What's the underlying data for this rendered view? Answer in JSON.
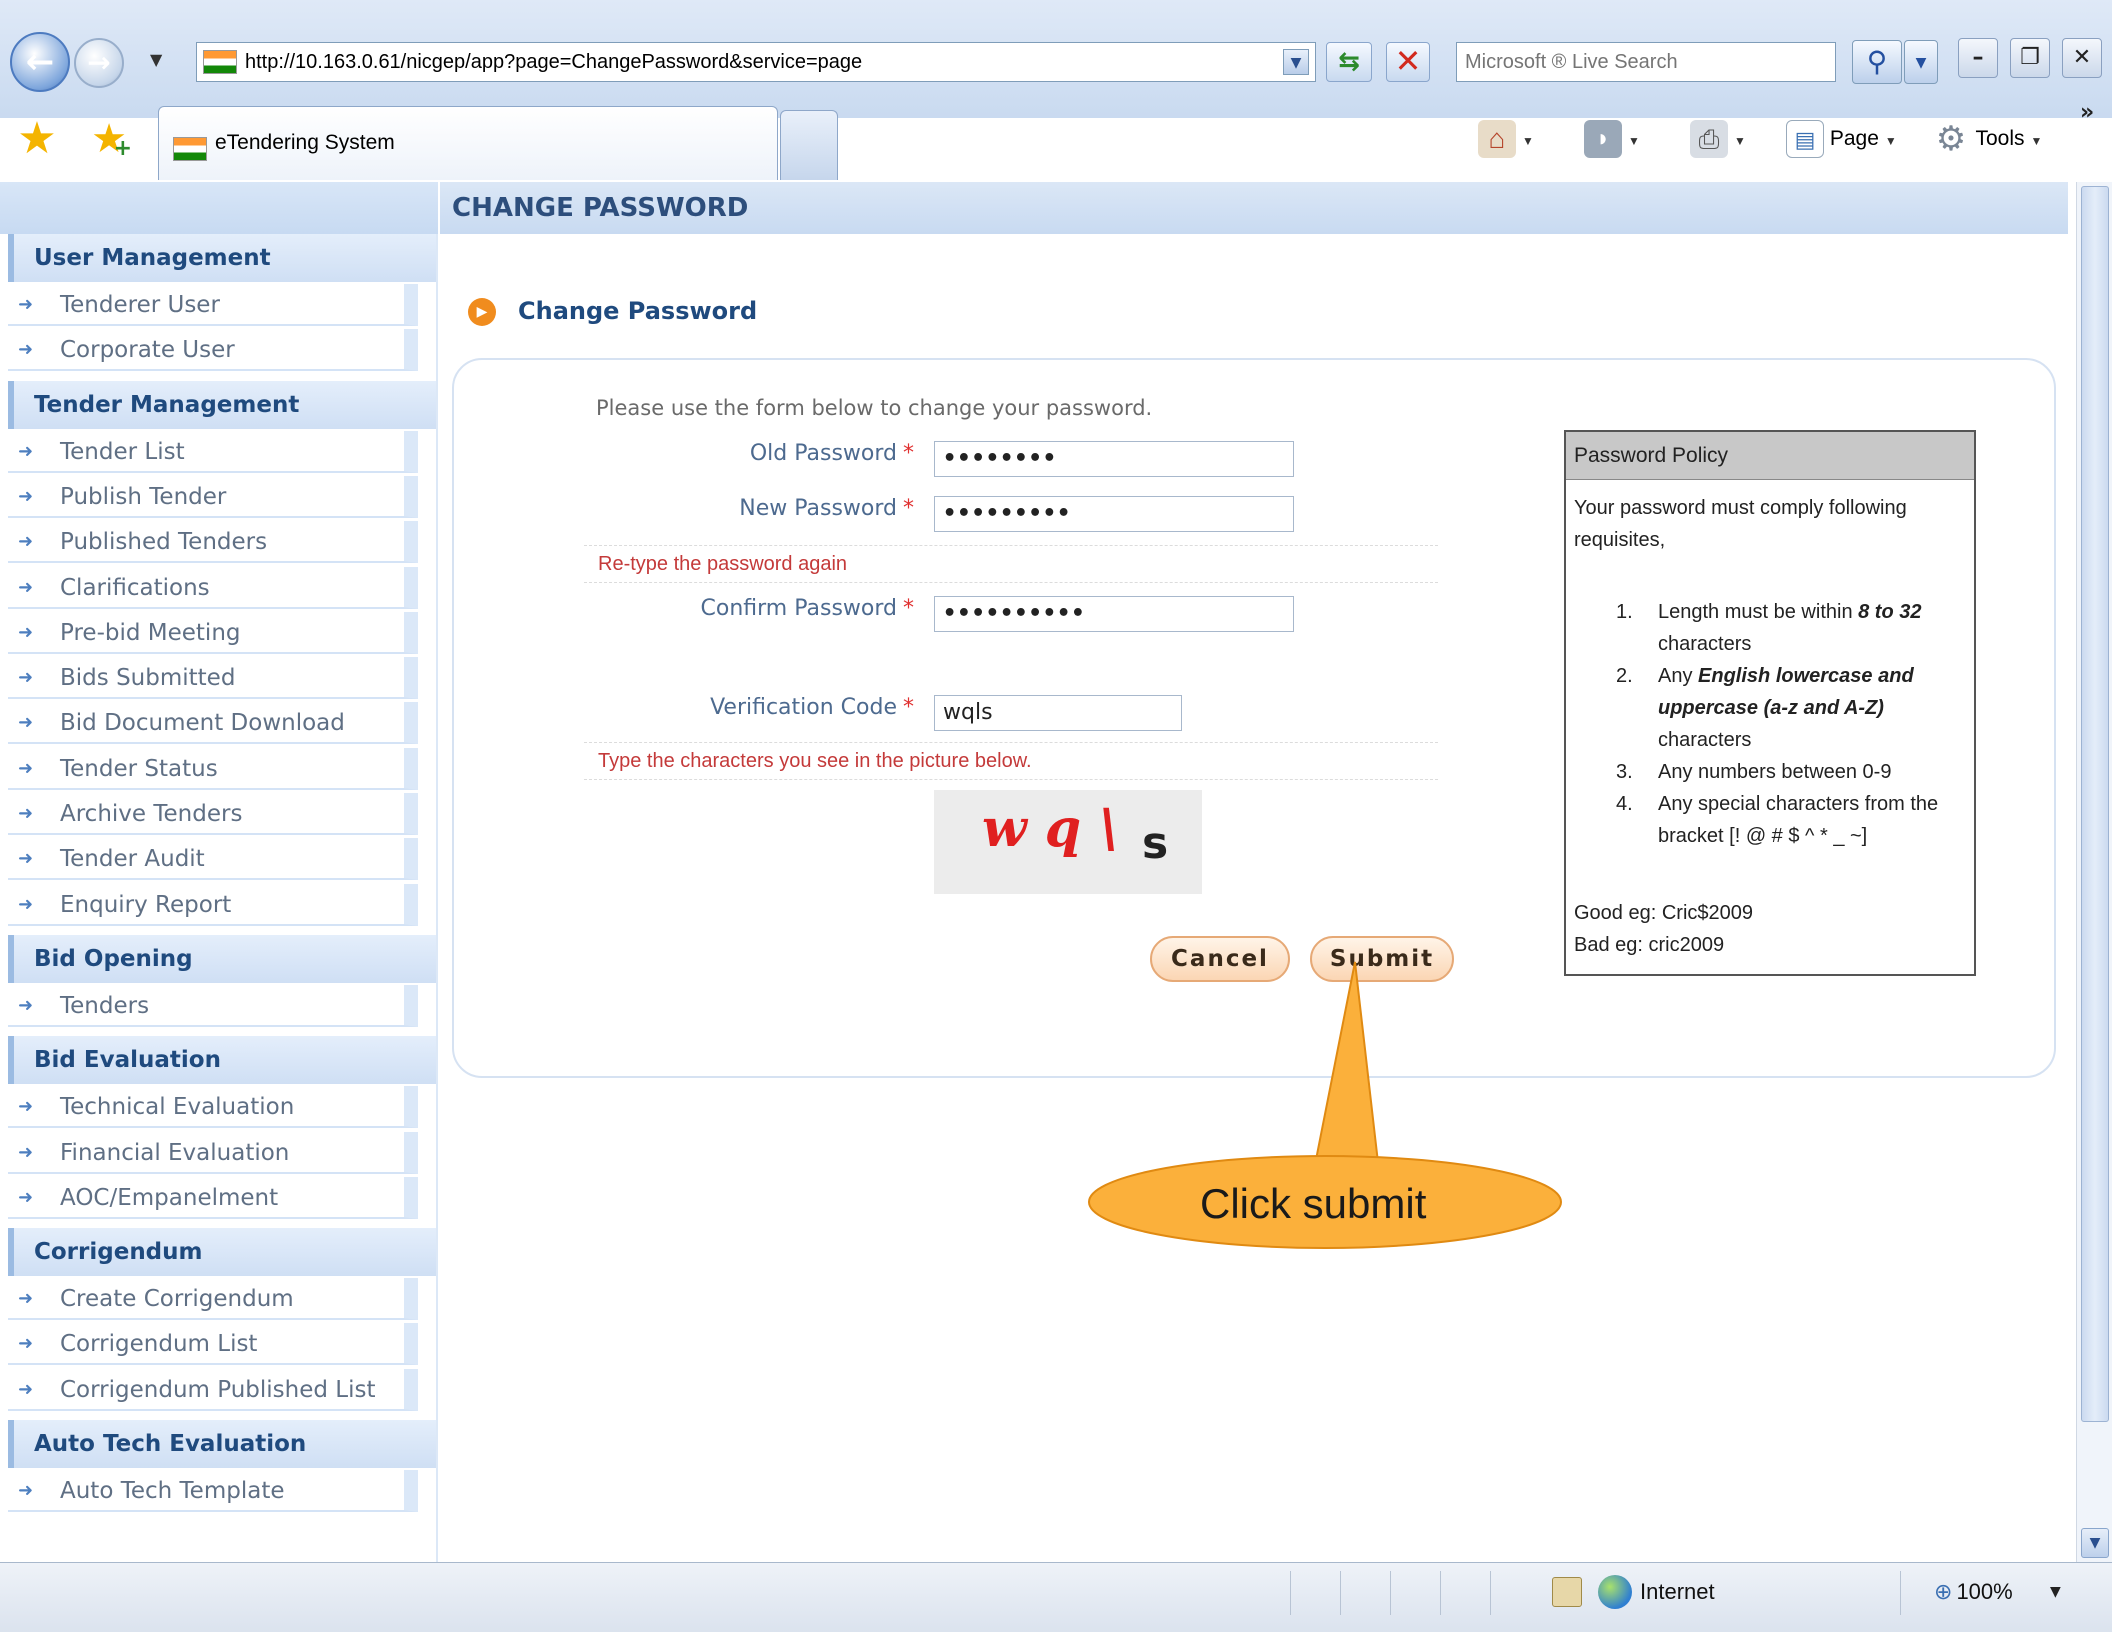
{
  "browser": {
    "address": "http://10.163.0.61/nicgep/app?page=ChangePassword&service=page",
    "search_placeholder": "Microsoft ® Live Search",
    "tab_title": "eTendering System",
    "page_cmd": "Page",
    "tools_cmd": "Tools",
    "zone": "Internet",
    "zoom": "100%"
  },
  "sidebar": {
    "groups": [
      {
        "title": "User Management",
        "items": [
          "Tenderer User",
          "Corporate User"
        ]
      },
      {
        "title": "Tender Management",
        "items": [
          "Tender List",
          "Publish Tender",
          "Published Tenders",
          "Clarifications",
          "Pre-bid Meeting",
          "Bids Submitted",
          "Bid Document Download",
          "Tender Status",
          "Archive Tenders",
          "Tender Audit",
          "Enquiry Report"
        ]
      },
      {
        "title": "Bid Opening",
        "items": [
          "Tenders"
        ]
      },
      {
        "title": "Bid Evaluation",
        "items": [
          "Technical Evaluation",
          "Financial Evaluation",
          "AOC/Empanelment"
        ]
      },
      {
        "title": "Corrigendum",
        "items": [
          "Create Corrigendum",
          "Corrigendum List",
          "Corrigendum Published List"
        ]
      },
      {
        "title": "Auto Tech Evaluation",
        "items": [
          "Auto Tech Template"
        ]
      }
    ]
  },
  "page": {
    "header": "CHANGE PASSWORD",
    "section_title": "Change Password"
  },
  "form": {
    "intro": "Please use the form below to change your password.",
    "old_label": "Old Password",
    "old_value": "••••••••",
    "new_label": "New Password",
    "new_value": "•••••••••",
    "retype_hint": "Re-type the password again",
    "confirm_label": "Confirm Password",
    "confirm_value": "••••••••••",
    "verify_label": "Verification Code",
    "verify_value": "wqls",
    "captcha_hint": "Type the characters you see in the picture below.",
    "required_mark": "*",
    "captcha_red": "wq\\",
    "captcha_dark": "s",
    "cancel_label": "Cancel",
    "submit_label": "Submit"
  },
  "policy": {
    "title": "Password Policy",
    "intro": "Your password must comply following requisites,",
    "rules": [
      {
        "num": "1.",
        "text": "Length must be within ",
        "em": "8 to 32",
        "tail": " characters"
      },
      {
        "num": "2.",
        "text": "Any ",
        "em": "English lowercase and uppercase (a-z and A-Z)",
        "tail": " characters"
      },
      {
        "num": "3.",
        "text": "Any numbers between 0-9",
        "em": "",
        "tail": ""
      },
      {
        "num": "4.",
        "text": "Any special characters from the bracket [! @ # $ ^ * _ ~]",
        "em": "",
        "tail": ""
      }
    ],
    "good": "Good eg: Cric$2009",
    "bad": "Bad eg: cric2009"
  },
  "callout": {
    "text": "Click submit",
    "fill": "#fbb03b"
  }
}
